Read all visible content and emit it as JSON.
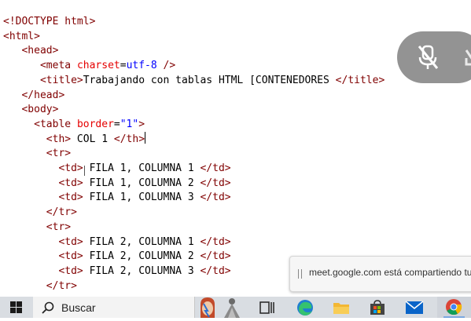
{
  "code_lines": [
    {
      "indent": "",
      "parts": [
        {
          "c": "tag",
          "t": "<!DOCTYPE html>"
        }
      ]
    },
    {
      "indent": "",
      "parts": [
        {
          "c": "tag",
          "t": "<html>"
        }
      ]
    },
    {
      "indent": "   ",
      "parts": [
        {
          "c": "tag",
          "t": "<head>"
        }
      ]
    },
    {
      "indent": "      ",
      "parts": [
        {
          "c": "tag",
          "t": "<meta "
        },
        {
          "c": "attr",
          "t": "charset"
        },
        {
          "c": "txt",
          "t": "="
        },
        {
          "c": "val",
          "t": "utf-8"
        },
        {
          "c": "tag",
          "t": " />"
        }
      ]
    },
    {
      "indent": "      ",
      "parts": [
        {
          "c": "tag",
          "t": "<title>"
        },
        {
          "c": "txt",
          "t": "Trabajando con tablas HTML [CONTENEDORES "
        },
        {
          "c": "tag",
          "t": "</title>"
        }
      ]
    },
    {
      "indent": "   ",
      "parts": [
        {
          "c": "tag",
          "t": "</head>"
        }
      ]
    },
    {
      "indent": "   ",
      "parts": [
        {
          "c": "tag",
          "t": "<body>"
        }
      ]
    },
    {
      "indent": "     ",
      "parts": [
        {
          "c": "tag",
          "t": "<table "
        },
        {
          "c": "attr",
          "t": "border"
        },
        {
          "c": "txt",
          "t": "="
        },
        {
          "c": "val",
          "t": "\"1\""
        },
        {
          "c": "tag",
          "t": ">"
        }
      ]
    },
    {
      "indent": "       ",
      "parts": [
        {
          "c": "tag",
          "t": "<th>"
        },
        {
          "c": "txt",
          "t": " COL 1 "
        },
        {
          "c": "tag",
          "t": "</th>"
        }
      ],
      "caret": true
    },
    {
      "indent": "       ",
      "parts": [
        {
          "c": "tag",
          "t": "<tr>"
        }
      ]
    },
    {
      "indent": "         ",
      "parts": [
        {
          "c": "tag",
          "t": "<td>"
        },
        {
          "c": "txt",
          "t": " FILA 1, COLUMNA 1 "
        },
        {
          "c": "tag",
          "t": "</td>"
        }
      ]
    },
    {
      "indent": "         ",
      "parts": [
        {
          "c": "tag",
          "t": "<td>"
        },
        {
          "c": "txt",
          "t": " FILA 1, COLUMNA 2 "
        },
        {
          "c": "tag",
          "t": "</td>"
        }
      ]
    },
    {
      "indent": "         ",
      "parts": [
        {
          "c": "tag",
          "t": "<td>"
        },
        {
          "c": "txt",
          "t": " FILA 1, COLUMNA 3 "
        },
        {
          "c": "tag",
          "t": "</td>"
        }
      ]
    },
    {
      "indent": "       ",
      "parts": [
        {
          "c": "tag",
          "t": "</tr>"
        }
      ]
    },
    {
      "indent": "       ",
      "parts": [
        {
          "c": "tag",
          "t": "<tr>"
        }
      ]
    },
    {
      "indent": "         ",
      "parts": [
        {
          "c": "tag",
          "t": "<td>"
        },
        {
          "c": "txt",
          "t": " FILA 2, COLUMNA 1 "
        },
        {
          "c": "tag",
          "t": "</td>"
        }
      ]
    },
    {
      "indent": "         ",
      "parts": [
        {
          "c": "tag",
          "t": "<td>"
        },
        {
          "c": "txt",
          "t": " FILA 2, COLUMNA 2 "
        },
        {
          "c": "tag",
          "t": "</td>"
        }
      ]
    },
    {
      "indent": "         ",
      "parts": [
        {
          "c": "tag",
          "t": "<td>"
        },
        {
          "c": "txt",
          "t": " FILA 2, COLUMNA 3 "
        },
        {
          "c": "tag",
          "t": "</td>"
        }
      ]
    },
    {
      "indent": "       ",
      "parts": [
        {
          "c": "tag",
          "t": "</tr>"
        }
      ]
    }
  ],
  "syntax_colors": {
    "tag": "#800000",
    "attr": "#e50000",
    "value": "#0000ff",
    "text": "#000000"
  },
  "meet_overlay": {
    "mic_icon": "mic-off-icon",
    "share_text": "meet.google.com está compartiendo tu p"
  },
  "taskbar": {
    "search_placeholder": "Buscar",
    "icons": [
      "windows-start-icon",
      "search-icon",
      "task-view-icon",
      "edge-icon",
      "file-explorer-icon",
      "microsoft-store-icon",
      "mail-icon",
      "chrome-icon"
    ]
  }
}
